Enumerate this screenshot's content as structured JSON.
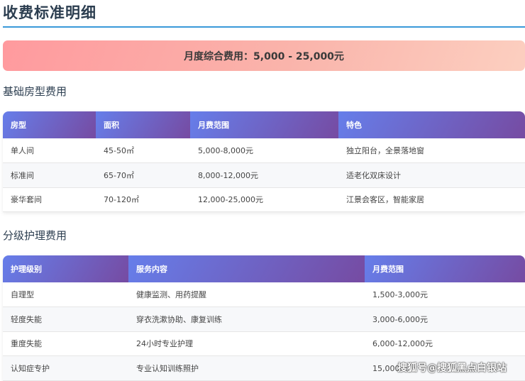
{
  "title": "收费标准明细",
  "banner": "月度综合费用：5,000 - 25,000元",
  "room_section": {
    "heading": "基础房型费用",
    "headers": [
      "房型",
      "面积",
      "月费范围",
      "特色"
    ],
    "rows": [
      [
        "单人间",
        "45-50㎡",
        "5,000-8,000元",
        "独立阳台，全景落地窗"
      ],
      [
        "标准间",
        "65-70㎡",
        "8,000-12,000元",
        "适老化双床设计"
      ],
      [
        "豪华套间",
        "70-120㎡",
        "12,000-25,000元",
        "江景会客区，智能家居"
      ]
    ]
  },
  "care_section": {
    "heading": "分级护理费用",
    "headers": [
      "护理级别",
      "服务内容",
      "月费范围"
    ],
    "rows": [
      [
        "自理型",
        "健康监测、用药提醒",
        "1,500-3,000元"
      ],
      [
        "轻度失能",
        "穿衣洗漱协助、康复训练",
        "3,000-6,000元"
      ],
      [
        "重度失能",
        "24小时专业护理",
        "6,000-12,000元"
      ],
      [
        "认知症专护",
        "专业认知训练照护",
        "15,000元"
      ]
    ]
  },
  "watermark": "搜狐号@搜狐黑点白银站"
}
